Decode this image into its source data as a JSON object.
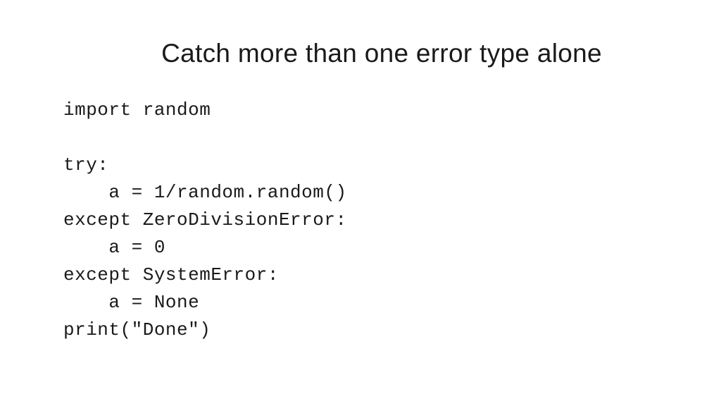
{
  "slide": {
    "title": "Catch more than one error type alone",
    "code": "import random\n\ntry:\n    a = 1/random.random()\nexcept ZeroDivisionError:\n    a = 0\nexcept SystemError:\n    a = None\nprint(\"Done\")"
  }
}
